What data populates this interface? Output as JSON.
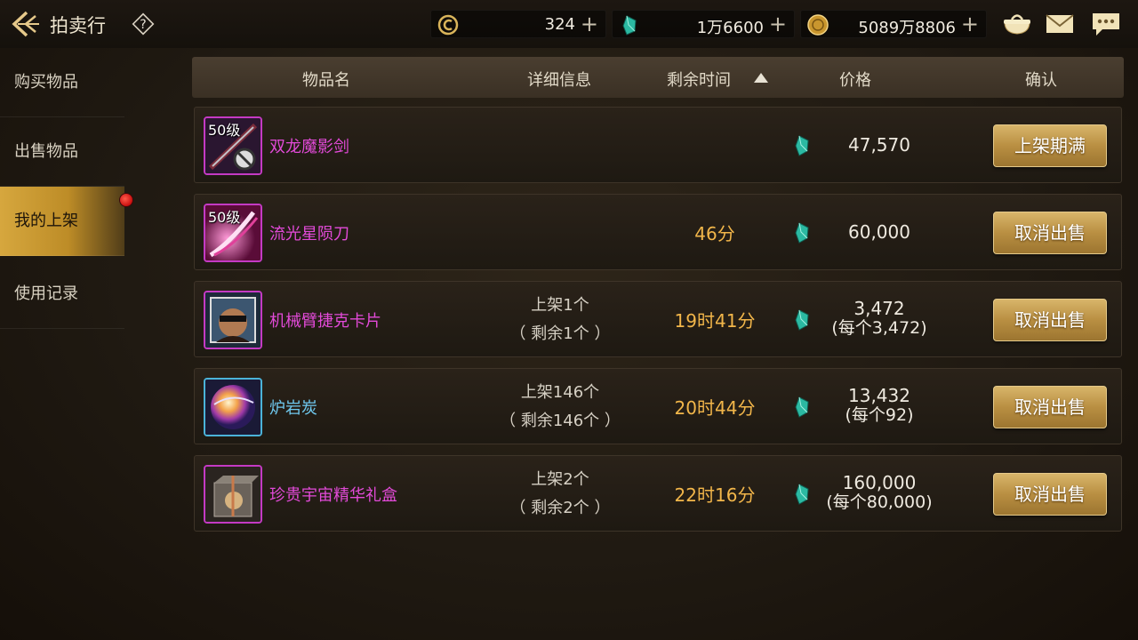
{
  "header": {
    "title": "拍卖行",
    "help_icon": "question-icon",
    "currencies": [
      {
        "icon": "coupon-icon",
        "value": "324",
        "plus": "+"
      },
      {
        "icon": "gem-icon",
        "value": "1万6600",
        "plus": "+"
      },
      {
        "icon": "gold-coin-icon",
        "value": "5089万8806",
        "plus": "+"
      }
    ],
    "actions": [
      "bag-icon",
      "mail-icon",
      "chat-icon"
    ]
  },
  "sidebar": {
    "items": [
      {
        "label": "购买物品"
      },
      {
        "label": "出售物品"
      },
      {
        "label": "我的上架",
        "active": true
      },
      {
        "label": "使用记录"
      }
    ]
  },
  "table": {
    "headers": {
      "name": "物品名",
      "detail": "详细信息",
      "time": "剩余时间",
      "price": "价格",
      "confirm": "确认"
    },
    "rows": [
      {
        "level": "50级",
        "name": "双龙魔影剑",
        "detail_line1": "",
        "detail_line2": "",
        "time": "",
        "price": "47,570",
        "price_each": "",
        "action": "上架期满",
        "rarity": "purple",
        "icon": "sword-icon"
      },
      {
        "level": "50级",
        "name": "流光星陨刀",
        "detail_line1": "",
        "detail_line2": "",
        "time": "46分",
        "price": "60,000",
        "price_each": "",
        "action": "取消出售",
        "rarity": "purple",
        "icon": "blade-icon"
      },
      {
        "level": "",
        "name": "机械臂捷克卡片",
        "detail_line1": "上架1个",
        "detail_line2": "（ 剩余1个 ）",
        "time": "19时41分",
        "price": "3,472",
        "price_each": "(每个3,472)",
        "action": "取消出售",
        "rarity": "purple",
        "icon": "card-icon"
      },
      {
        "level": "",
        "name": "炉岩炭",
        "detail_line1": "上架146个",
        "detail_line2": "（ 剩余146个 ）",
        "time": "20时44分",
        "price": "13,432",
        "price_each": "(每个92)",
        "action": "取消出售",
        "rarity": "blue",
        "icon": "orb-icon"
      },
      {
        "level": "",
        "name": "珍贵宇宙精华礼盒",
        "detail_line1": "上架2个",
        "detail_line2": "（ 剩余2个 ）",
        "time": "22时16分",
        "price": "160,000",
        "price_each": "(每个80,000)",
        "action": "取消出售",
        "rarity": "purple",
        "icon": "gift-box-icon"
      }
    ]
  },
  "colors": {
    "accent": "#c9a14e",
    "time": "#f2b64a",
    "purple_name": "#e24ad8",
    "blue_name": "#6fc8ee"
  }
}
